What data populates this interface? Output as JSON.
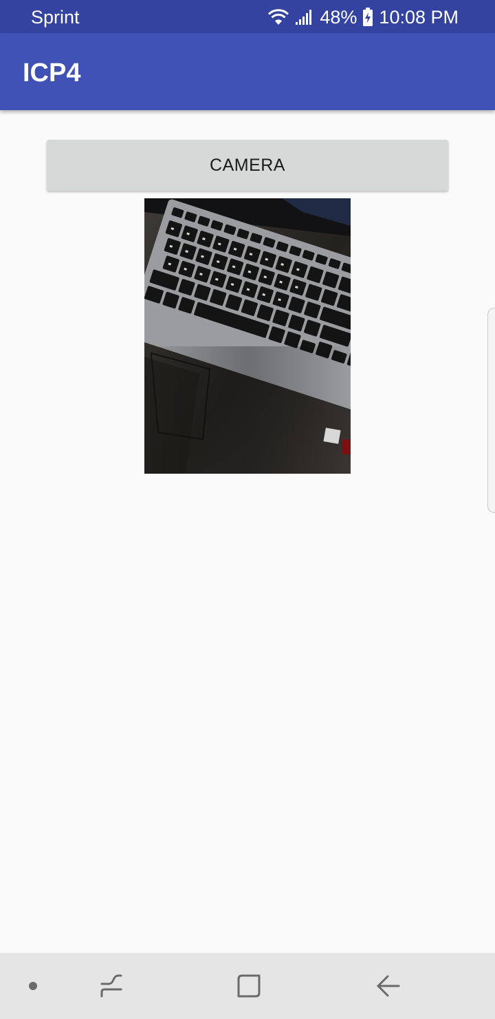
{
  "status_bar": {
    "carrier": "Sprint",
    "battery_percent": "48%",
    "time": "10:08 PM",
    "icons": [
      "wifi-icon",
      "signal-icon",
      "battery-charging-icon"
    ]
  },
  "app_bar": {
    "title": "ICP4"
  },
  "main": {
    "camera_button_label": "CAMERA",
    "photo_description_icon": "captured-photo"
  },
  "nav_bar": {
    "icons": [
      "dot-icon",
      "recent-apps-icon",
      "home-icon",
      "back-icon"
    ]
  },
  "colors": {
    "status_bar": "#3443a0",
    "app_bar": "#3f51b5",
    "background": "#fafafa",
    "button": "#d7d8d8",
    "nav_bar": "#e5e5e5"
  }
}
